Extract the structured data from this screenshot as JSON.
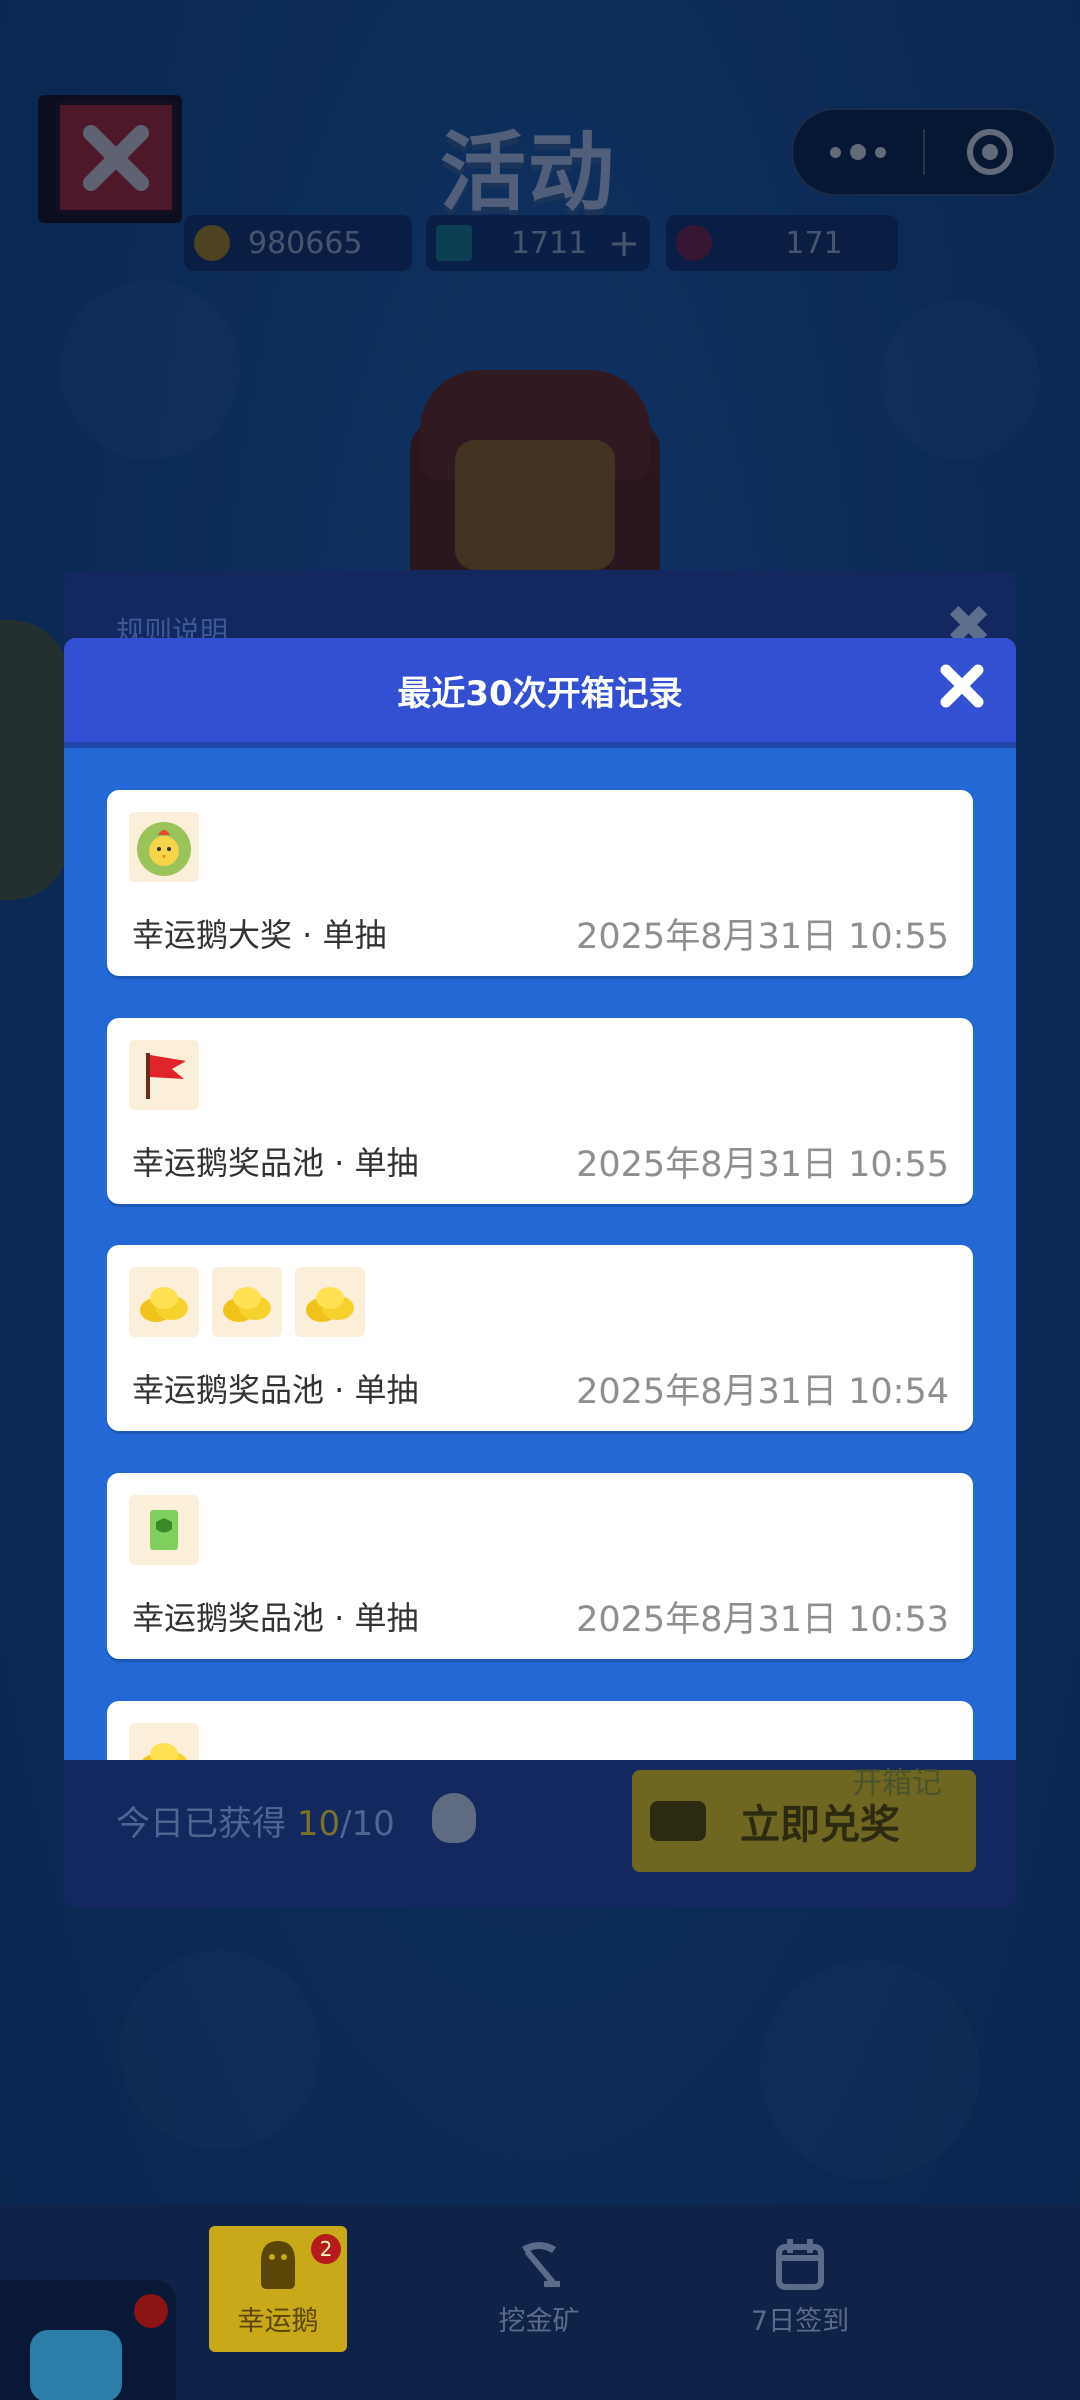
{
  "background": {
    "title": "活动",
    "resources": [
      {
        "name": "coins",
        "value": "980665"
      },
      {
        "name": "diamonds",
        "value": "1711"
      },
      {
        "name": "tickets",
        "value": "171"
      }
    ],
    "rule_panel_title": "规则说明",
    "today_label_prefix": "今日已获得 ",
    "today_count": "10",
    "today_total": "/10",
    "redeem_label": "立即兑奖",
    "open_badge": "开箱记"
  },
  "modal": {
    "title": "最近30次开箱记录",
    "records": [
      {
        "name": "幸运鹅大奖 · 单抽",
        "time": "2025年8月31日 10:55",
        "icons": [
          "lettuce-duck-icon"
        ]
      },
      {
        "name": "幸运鹅奖品池 · 单抽",
        "time": "2025年8月31日 10:55",
        "icons": [
          "red-flag-icon"
        ]
      },
      {
        "name": "幸运鹅奖品池 · 单抽",
        "time": "2025年8月31日 10:54",
        "icons": [
          "gold-coins-icon",
          "gold-coins-icon",
          "gold-coins-icon"
        ]
      },
      {
        "name": "幸运鹅奖品池 · 单抽",
        "time": "2025年8月31日 10:53",
        "icons": [
          "green-card-icon"
        ]
      },
      {
        "name": "",
        "time": "",
        "icons": [
          "gold-coins-icon"
        ]
      }
    ]
  },
  "nav": {
    "items": [
      {
        "label": "幸运鹅",
        "badge": "2"
      },
      {
        "label": "挖金矿"
      },
      {
        "label": "7日签到"
      }
    ]
  },
  "colors": {
    "modal_header": "#3450d2",
    "modal_body": "#2468d6",
    "time_text": "#8f8f8f"
  }
}
